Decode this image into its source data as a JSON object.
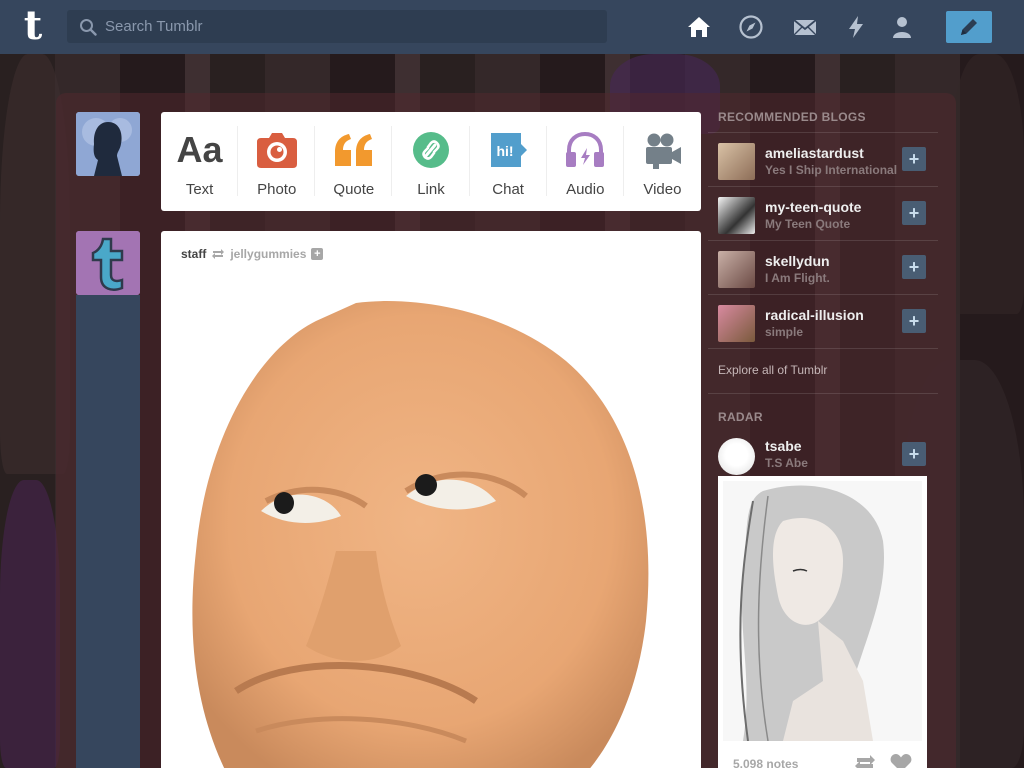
{
  "search": {
    "placeholder": "Search Tumblr"
  },
  "post_types": [
    {
      "label": "Text",
      "glyph": "Aa",
      "icon": "text-icon",
      "color": "#444444"
    },
    {
      "label": "Photo",
      "icon": "camera-icon",
      "color": "#d95e40"
    },
    {
      "label": "Quote",
      "icon": "quote-icon",
      "color": "#f2992e"
    },
    {
      "label": "Link",
      "icon": "link-icon",
      "color": "#56bc8a"
    },
    {
      "label": "Chat",
      "icon": "chat-icon",
      "color": "#529ecc"
    },
    {
      "label": "Audio",
      "icon": "headphones-icon",
      "color": "#a77dc2"
    },
    {
      "label": "Video",
      "icon": "video-camera-icon",
      "color": "#748089"
    }
  ],
  "post": {
    "author": "staff",
    "reblogged_from": "jellygummies",
    "plus_glyph": "+"
  },
  "sidebar": {
    "recommended_heading": "RECOMMENDED BLOGS",
    "blogs": [
      {
        "name": "ameliastardust",
        "title": "Yes I Ship International"
      },
      {
        "name": "my-teen-quote",
        "title": "My Teen Quote"
      },
      {
        "name": "skellydun",
        "title": "I Am Flight."
      },
      {
        "name": "radical-illusion",
        "title": "simple"
      }
    ],
    "follow_glyph": "+",
    "explore_link": "Explore all of Tumblr",
    "radar_heading": "RADAR",
    "radar": {
      "name": "tsabe",
      "title": "T.S Abe",
      "notes": "5,098 notes"
    }
  },
  "colors": {
    "topbar": "#36465d",
    "accent": "#529ecc"
  }
}
